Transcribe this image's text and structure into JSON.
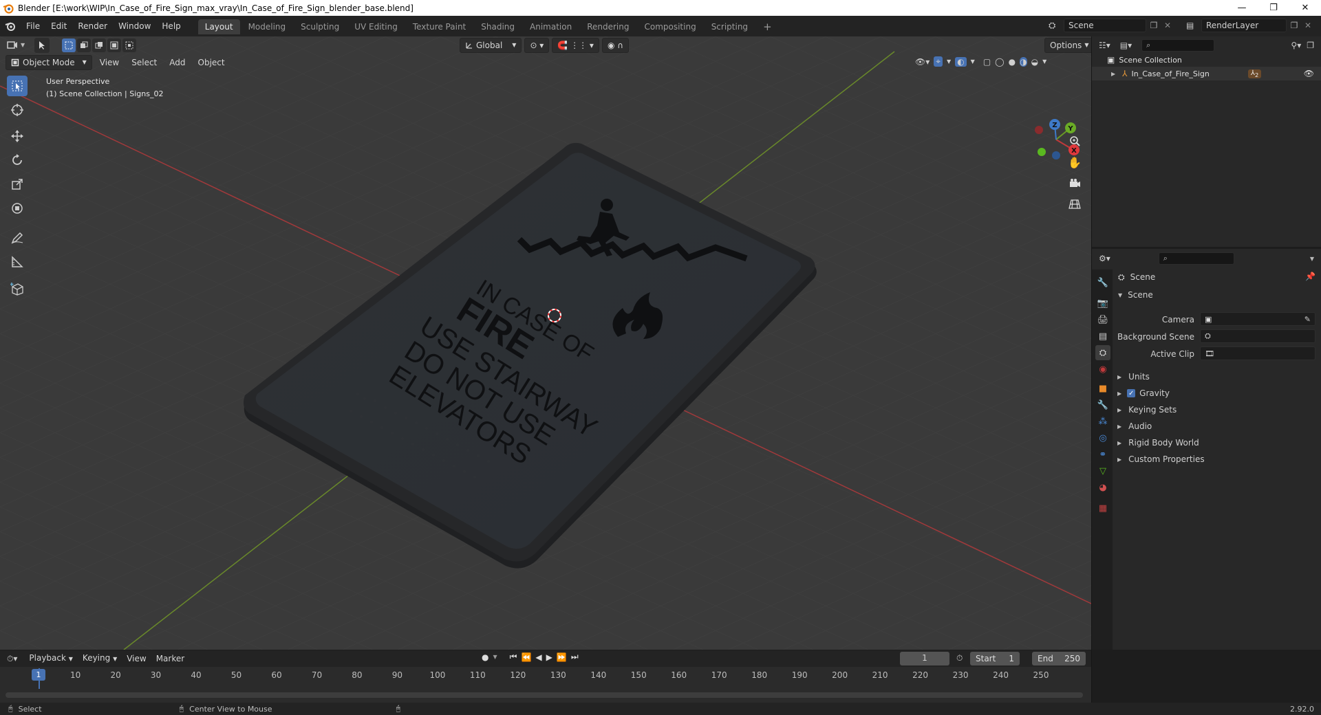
{
  "window": {
    "title": "Blender [E:\\work\\WIP\\In_Case_of_Fire_Sign_max_vray\\In_Case_of_Fire_Sign_blender_base.blend]",
    "controls": [
      "—",
      "❐",
      "✕"
    ]
  },
  "menus": [
    "File",
    "Edit",
    "Render",
    "Window",
    "Help"
  ],
  "workspaces": {
    "active": "Layout",
    "tabs": [
      "Layout",
      "Modeling",
      "Sculpting",
      "UV Editing",
      "Texture Paint",
      "Shading",
      "Animation",
      "Rendering",
      "Compositing",
      "Scripting"
    ],
    "add": "+"
  },
  "scene_selector": {
    "value": "Scene"
  },
  "view_layer": {
    "value": "RenderLayer"
  },
  "viewport": {
    "mode": "Object Mode",
    "menus": [
      "View",
      "Select",
      "Add",
      "Object"
    ],
    "transform_orientation": "Global",
    "options": "Options",
    "overlay_text": {
      "line1": "User Perspective",
      "line2": "(1) Scene Collection | Signs_02"
    },
    "gizmo_axes": [
      "X",
      "Y",
      "Z"
    ]
  },
  "sign": {
    "line1": "IN CASE OF",
    "line2": "FIRE",
    "line3": "USE STAIRWAY",
    "line4": "DO NOT USE",
    "line5": "ELEVATORS"
  },
  "outliner": {
    "root": "Scene Collection",
    "items": [
      {
        "label": "In_Case_of_Fire_Sign",
        "badge": "2"
      }
    ]
  },
  "properties": {
    "context": "Scene",
    "panel_title": "Scene",
    "fields": {
      "camera_label": "Camera",
      "background_label": "Background Scene",
      "clip_label": "Active Clip"
    },
    "sections": [
      "Units",
      "Gravity",
      "Keying Sets",
      "Audio",
      "Rigid Body World",
      "Custom Properties"
    ],
    "gravity_checked": true
  },
  "timeline": {
    "menus": [
      "Playback",
      "Keying",
      "View",
      "Marker"
    ],
    "current_frame": "1",
    "start_label": "Start",
    "start_value": "1",
    "end_label": "End",
    "end_value": "250",
    "ticks": [
      "1",
      "10",
      "20",
      "30",
      "40",
      "50",
      "60",
      "70",
      "80",
      "90",
      "100",
      "110",
      "120",
      "130",
      "140",
      "150",
      "160",
      "170",
      "180",
      "190",
      "200",
      "210",
      "220",
      "230",
      "240",
      "250"
    ]
  },
  "statusbar": {
    "select": "Select",
    "center_view": "Center View to Mouse",
    "version": "2.92.0"
  },
  "colors": {
    "accent": "#4772b3",
    "x_axis": "#c0393b",
    "y_axis": "#6a9a25",
    "z_axis": "#3e7ac8",
    "viewport_bg": "#3a3a3a",
    "sign_face": "#2d3034",
    "sign_frame": "#242424"
  }
}
